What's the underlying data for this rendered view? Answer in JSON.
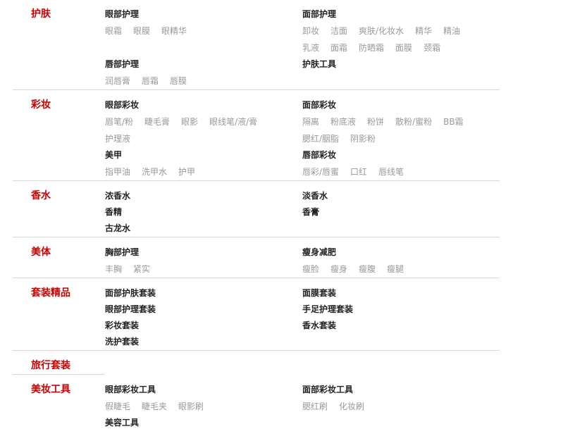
{
  "categories": [
    {
      "name": "护肤",
      "groups": [
        {
          "title": "眼部护理",
          "items": [
            "眼霜",
            "眼膜",
            "眼精华"
          ]
        },
        {
          "title": "面部护理",
          "items": [
            "卸妆",
            "洁面",
            "爽肤/化妆水",
            "精华",
            "精油",
            "乳液",
            "面霜",
            "防晒霜",
            "面膜",
            "颈霜"
          ]
        },
        {
          "title": "唇部护理",
          "items": [
            "润唇膏",
            "唇霜",
            "唇膜"
          ]
        },
        {
          "title": "护肤工具",
          "items": []
        }
      ]
    },
    {
      "name": "彩妆",
      "groups": [
        {
          "title": "眼部彩妆",
          "items": [
            "眉笔/粉",
            "睫毛膏",
            "眼影",
            "眼线笔/液/膏",
            "护理液"
          ]
        },
        {
          "title": "面部彩妆",
          "items": [
            "隔离",
            "粉底液",
            "粉饼",
            "散粉/蜜粉",
            "BB霜",
            "腮红/胭脂",
            "阴影粉"
          ]
        },
        {
          "title": "美甲",
          "items": [
            "指甲油",
            "洗甲水",
            "护甲"
          ]
        },
        {
          "title": "唇部彩妆",
          "items": [
            "唇彩/唇蜜",
            "口红",
            "唇线笔"
          ]
        }
      ]
    },
    {
      "name": "香水",
      "groups": [
        {
          "title": "浓香水",
          "items": []
        },
        {
          "title": "淡香水",
          "items": []
        },
        {
          "title": "香精",
          "items": []
        },
        {
          "title": "香膏",
          "items": []
        },
        {
          "title": "古龙水",
          "items": []
        }
      ]
    },
    {
      "name": "美体",
      "groups": [
        {
          "title": "胸部护理",
          "items": [
            "丰胸",
            "紧实"
          ]
        },
        {
          "title": "瘦身减肥",
          "items": [
            "瘦脸",
            "瘦身",
            "瘦腹",
            "瘦腿"
          ]
        }
      ]
    },
    {
      "name": "套装精品",
      "groups": [
        {
          "title": "面部护肤套装",
          "items": []
        },
        {
          "title": "面膜套装",
          "items": []
        },
        {
          "title": "眼部护理套装",
          "items": []
        },
        {
          "title": "手足护理套装",
          "items": []
        },
        {
          "title": "彩妆套装",
          "items": []
        },
        {
          "title": "香水套装",
          "items": []
        },
        {
          "title": "洗护套装",
          "items": []
        }
      ]
    },
    {
      "name": "旅行套装",
      "groups": []
    },
    {
      "name": "美妆工具",
      "groups": [
        {
          "title": "眼部彩妆工具",
          "items": [
            "假睫毛",
            "睫毛夹",
            "眼影刷"
          ]
        },
        {
          "title": "面部彩妆工具",
          "items": [
            "腮红刷",
            "化妆刷"
          ]
        },
        {
          "title": "美容工具",
          "items": []
        }
      ]
    }
  ]
}
